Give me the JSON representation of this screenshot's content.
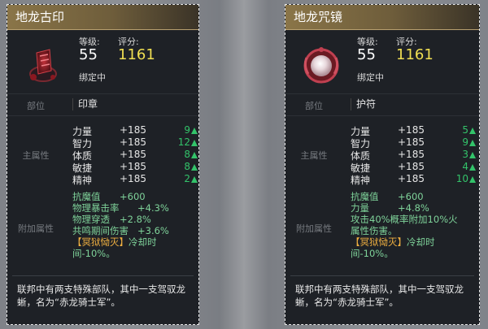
{
  "cards": [
    {
      "title": "地龙古印",
      "level_label": "等级:",
      "score_label": "评分:",
      "level": "55",
      "score": "1161",
      "bind_state": "绑定中",
      "slot_label": "部位",
      "slot_value": "印章",
      "main_attr_label": "主属性",
      "main_attrs": [
        {
          "name": "力量",
          "value": "+185",
          "up": "9"
        },
        {
          "name": "智力",
          "value": "+185",
          "up": "12"
        },
        {
          "name": "体质",
          "value": "+185",
          "up": "8"
        },
        {
          "name": "敏捷",
          "value": "+185",
          "up": "8"
        },
        {
          "name": "精神",
          "value": "+185",
          "up": "2"
        }
      ],
      "extra_label": "附加属性",
      "extra_lines": [
        {
          "name": "抗魔值",
          "value": "+600"
        },
        {
          "name": "物理暴击率",
          "value": "+4.3%"
        },
        {
          "name": "物理穿透",
          "value": "+2.8%"
        },
        {
          "name": "共鸣期间伤害",
          "value": "+3.6%"
        }
      ],
      "skill_name": "【冥狱恸灭】",
      "skill_text": "冷却时间-10%。",
      "description": "联邦中有两支特殊部队，其中一支驾驭龙蜥，名为“赤龙骑士军”。"
    },
    {
      "title": "地龙咒镜",
      "level_label": "等级:",
      "score_label": "评分:",
      "level": "55",
      "score": "1161",
      "bind_state": "绑定中",
      "slot_label": "部位",
      "slot_value": "护符",
      "main_attr_label": "主属性",
      "main_attrs": [
        {
          "name": "力量",
          "value": "+185",
          "up": "5"
        },
        {
          "name": "智力",
          "value": "+185",
          "up": "9"
        },
        {
          "name": "体质",
          "value": "+185",
          "up": "3"
        },
        {
          "name": "敏捷",
          "value": "+185",
          "up": "4"
        },
        {
          "name": "精神",
          "value": "+185",
          "up": "10"
        }
      ],
      "extra_label": "附加属性",
      "extra_lines": [
        {
          "name": "抗魔值",
          "value": "+600"
        },
        {
          "name": "力量",
          "value": "+4.8%"
        }
      ],
      "extra_sentence": "攻击40%概率附加10%火属性伤害。",
      "skill_name": "【冥狱恸灭】",
      "skill_text": "冷却时间-10%。",
      "description": "联邦中有两支特殊部队，其中一支驾驭龙蜥，名为“赤龙骑士军”。"
    }
  ],
  "colors": {
    "card_bg": "#1e2126",
    "title_gold": "#8a7548",
    "score_yellow": "#f1df52",
    "stat_green": "#33c36a",
    "extra_green": "#7fd39a",
    "skill_orange": "#f0b040"
  },
  "icons": [
    "seal-item-icon",
    "mirror-item-icon",
    "up-arrow-icon"
  ]
}
